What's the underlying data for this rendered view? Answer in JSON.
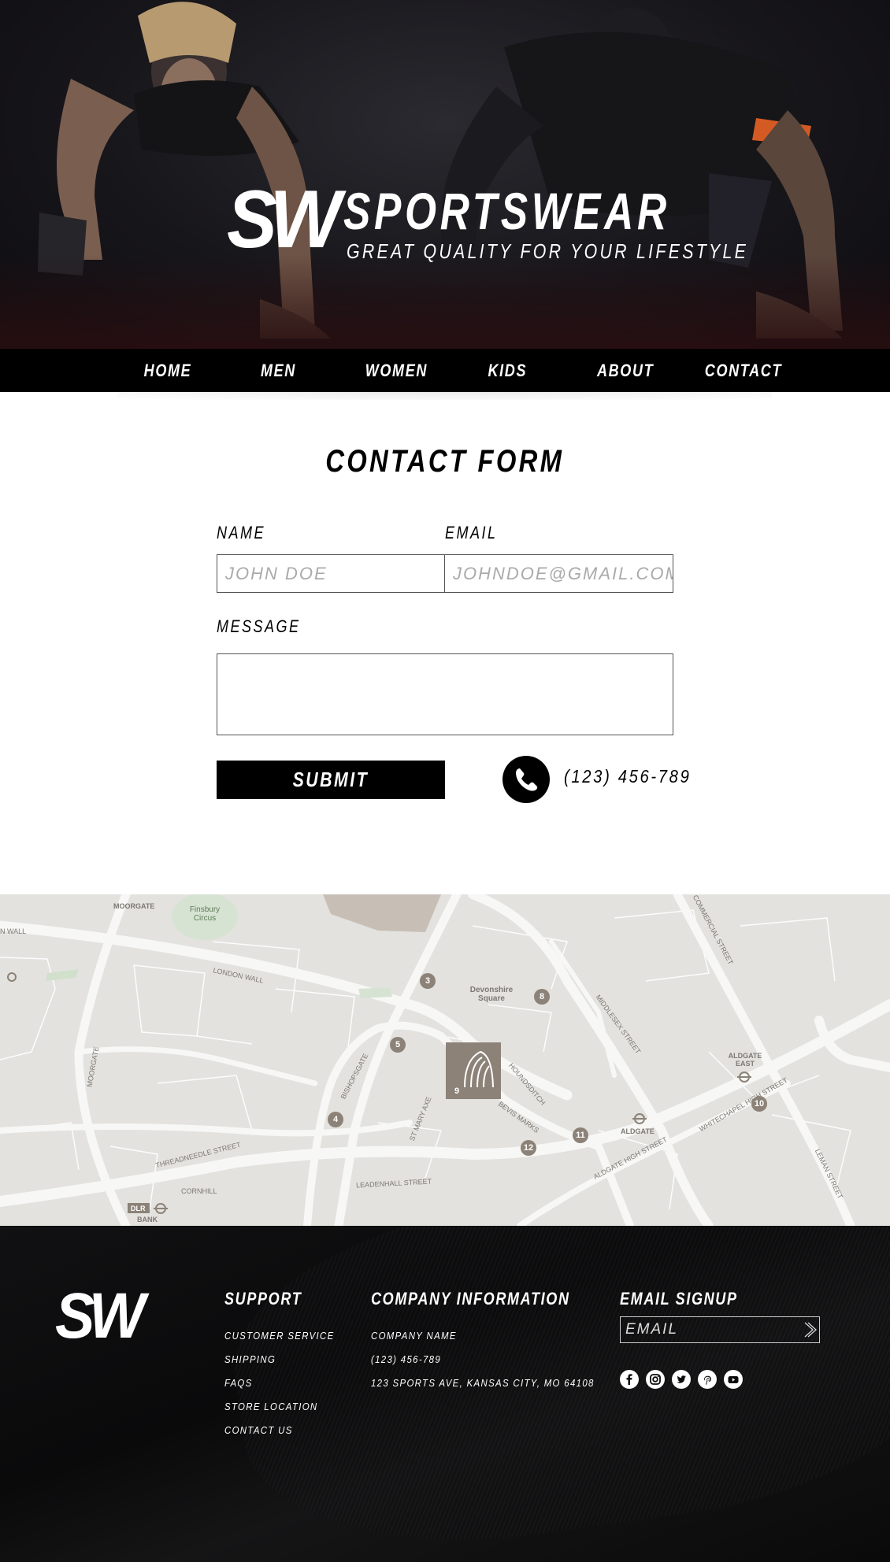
{
  "hero": {
    "logo": "SW",
    "brand_name": "SPORTSWEAR",
    "tagline": "GREAT QUALITY FOR YOUR LIFESTYLE"
  },
  "nav": {
    "items": [
      "HOME",
      "MEN",
      "WOMEN",
      "KIDS",
      "ABOUT",
      "CONTACT"
    ]
  },
  "contact_form": {
    "title": "CONTACT FORM",
    "name_label": "NAME",
    "name_placeholder": "JOHN DOE",
    "email_label": "EMAIL",
    "email_placeholder": "JOHNDOE@GMAIL.COM",
    "message_label": "MESSAGE",
    "submit_label": "SUBMIT",
    "phone": "(123) 456-789"
  },
  "map": {
    "labels": {
      "moorgate": "MOORGATE",
      "finsbury_circus": "Finsbury Circus",
      "london_wall": "LONDON WALL",
      "devonshire_square": "Devonshire Square",
      "middlesex_street": "MIDDLESEX STREET",
      "commercial_street": "COMMERCIAL STREET",
      "aldgate_east": "ALDGATE EAST",
      "whitechapel_high_street": "WHITECHAPEL HIGH STREET",
      "aldgate": "ALDGATE",
      "aldgate_high_street": "ALDGATE HIGH STREET",
      "bishopsgate": "BISHOPSGATE",
      "houndsditch": "HOUNDSDITCH",
      "bevis_marks": "BEVIS MARKS",
      "st_mary_axe": "ST MARY AXE",
      "threadneedle_street": "THREADNEEDLE STREET",
      "cornhill": "CORNHILL",
      "leadenhall_street": "LEADENHALL STREET",
      "leman_street": "LEMAN STREET",
      "moorgate_road": "MOORGATE",
      "dlr": "DLR",
      "bank": "BANK",
      "wall_left": "N WALL"
    },
    "pins": [
      "3",
      "8",
      "5",
      "9",
      "4",
      "11",
      "12",
      "10"
    ]
  },
  "footer": {
    "logo": "SW",
    "support": {
      "heading": "SUPPORT",
      "links": [
        "CUSTOMER SERVICE",
        "SHIPPING",
        "FAQS",
        "STORE LOCATION",
        "CONTACT US"
      ]
    },
    "company": {
      "heading": "COMPANY INFORMATION",
      "lines": [
        "COMPANY NAME",
        "(123) 456-789",
        "123 SPORTS AVE, KANSAS CITY, MO 64108"
      ]
    },
    "signup": {
      "heading": "EMAIL SIGNUP",
      "placeholder": "EMAIL"
    },
    "social": [
      "facebook-icon",
      "instagram-icon",
      "twitter-icon",
      "pinterest-icon",
      "youtube-icon"
    ]
  }
}
